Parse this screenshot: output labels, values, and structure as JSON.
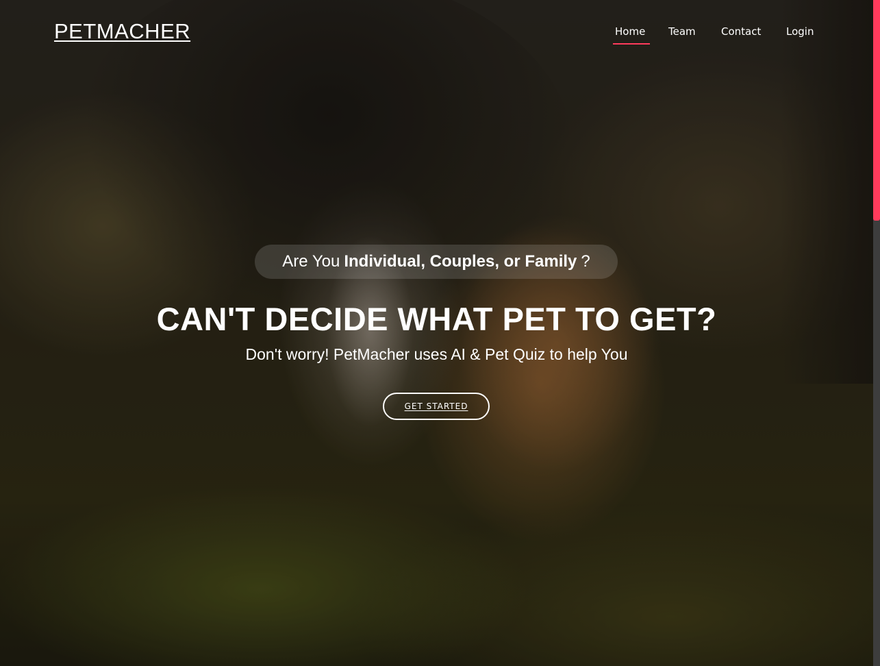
{
  "brand": {
    "logo_text": "PETMACHER"
  },
  "nav": {
    "items": [
      {
        "label": "Home",
        "active": true
      },
      {
        "label": "Team",
        "active": false
      },
      {
        "label": "Contact",
        "active": false
      },
      {
        "label": "Login",
        "active": false
      }
    ],
    "active_color": "#ff3b5c"
  },
  "hero": {
    "pill": {
      "prefix": "Are You",
      "emphasis": "Individual, Couples, or Family",
      "suffix": "?"
    },
    "headline": "CAN'T DECIDE WHAT PET TO GET?",
    "subline": "Don't worry! PetMacher uses AI & Pet Quiz to help You",
    "cta_label": "GET STARTED",
    "background_image": "two corgis sitting on mossy ground under a tree"
  },
  "scrollbar": {
    "thumb_color": "#ff3b5c"
  }
}
